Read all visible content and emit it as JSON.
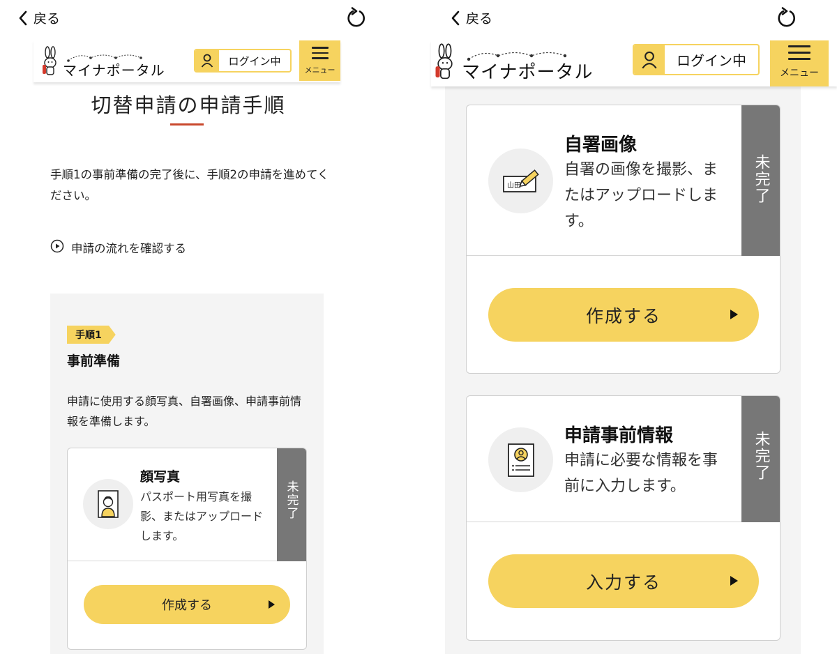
{
  "colors": {
    "accent_yellow": "#f6d35f",
    "status_gray": "#777777",
    "title_rule": "#c9482c",
    "panel_gray": "#f4f4f4"
  },
  "nav": {
    "back_label": "戻る",
    "back_icon": "chevron-left-icon",
    "reload_icon": "reload-icon"
  },
  "header": {
    "logo_text": "マイナポータル",
    "login_label": "ログイン中",
    "login_icon": "person-icon",
    "menu_label": "メニュー",
    "menu_icon": "hamburger-icon"
  },
  "page": {
    "title": "切替申請の申請手順",
    "intro": "手順1の事前準備の完了後に、手順2の申請を進めてください。",
    "flow_link": "申請の流れを確認する",
    "flow_icon": "play-circle-icon"
  },
  "step1": {
    "tag": "手順1",
    "heading": "事前準備",
    "description": "申請に使用する顔写真、自署画像、申請事前情報を準備します。"
  },
  "cards": {
    "face_photo": {
      "title": "顔写真",
      "description": "パスポート用写真を撮影、またはアップロードします。",
      "status": "未完了",
      "button": "作成する",
      "icon": "face-photo-icon"
    },
    "signature": {
      "title": "自署画像",
      "description": "自署の画像を撮影、またはアップロードします。",
      "status": "未完了",
      "button": "作成する",
      "icon": "signature-icon",
      "icon_text": "山田"
    },
    "pre_info": {
      "title": "申請事前情報",
      "description": "申請に必要な情報を事前に入力します。",
      "status": "未完了",
      "button": "入力する",
      "icon": "document-icon"
    }
  }
}
